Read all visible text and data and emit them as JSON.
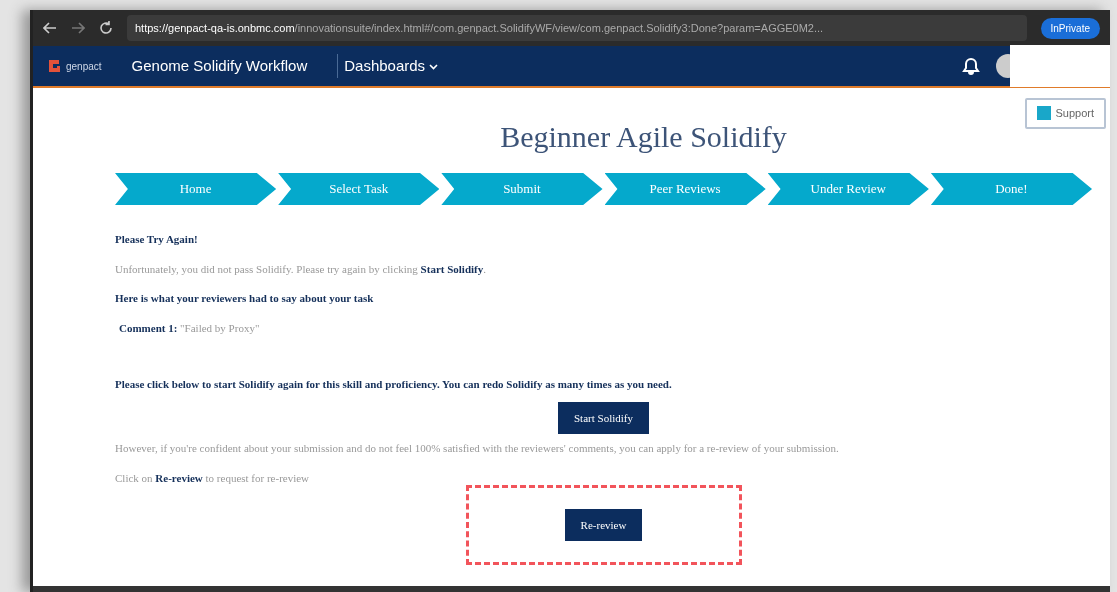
{
  "browser": {
    "url_host": "https://genpact-qa-is.onbmc.com",
    "url_path": "/innovationsuite/index.html#/com.genpact.SolidifyWF/view/com.genpact.Solidify3:Done?param=AGGE0M2...",
    "profile": "InPrivate"
  },
  "navbar": {
    "logo": "genpact",
    "app_title": "Genome Solidify Workflow",
    "menu": "Dashboards"
  },
  "support": "Support",
  "title": "Beginner Agile Solidify",
  "steps": [
    {
      "label": "Home"
    },
    {
      "label": "Select Task"
    },
    {
      "label": "Submit"
    },
    {
      "label": "Peer Reviews"
    },
    {
      "label": "Under Review"
    },
    {
      "label": "Done!"
    }
  ],
  "content": [
    {
      "kind": "heading",
      "text": "Please Try Again!"
    },
    {
      "kind": "text",
      "text": "Unfortunately, you did not pass Solidify. Please try again by clicking **Start Solidify**."
    },
    {
      "kind": "heading",
      "text": "Here is what your reviewers had to say about your task"
    },
    {
      "kind": "comment",
      "text": "**Comment 1:** \"Failed by Proxy\""
    },
    {
      "kind": "heading",
      "text": "Please click below to start Solidify again for this skill and proficiency. You can redo Solidify as many times as you need."
    },
    {
      "kind": "button",
      "text": "Start Solidify",
      "highlighted": false
    },
    {
      "kind": "text",
      "text": "However, if you're confident about your submission and do not feel 100% satisfied with the reviewers' comments, you can apply for a re-review of your submission."
    },
    {
      "kind": "text",
      "text": "Click on **Re-review** to request for re-review"
    },
    {
      "kind": "button",
      "text": "Re-review",
      "highlighted": true
    }
  ]
}
